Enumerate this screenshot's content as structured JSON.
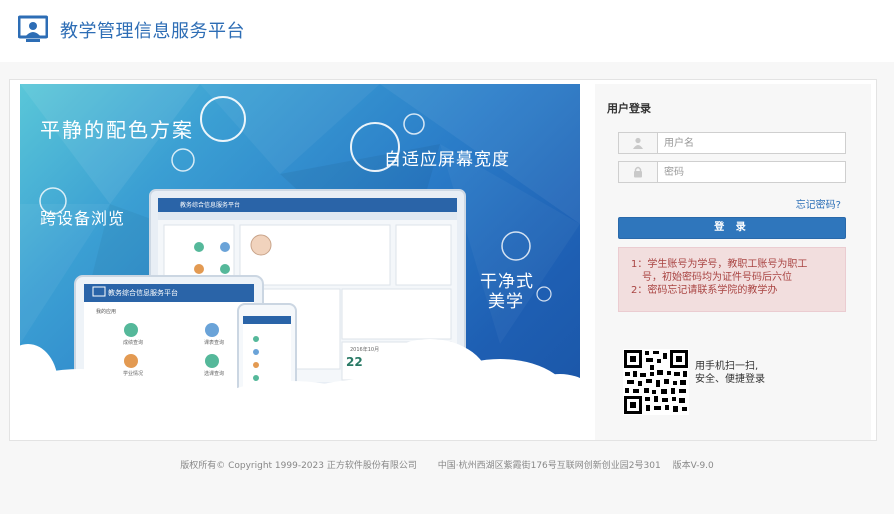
{
  "header": {
    "title": "教学管理信息服务平台",
    "logo_icon": "monitor-user-icon",
    "brand_color": "#2d6db5"
  },
  "banner": {
    "slogan_1": "平静的配色方案",
    "slogan_2": "自适应屏幕宽度",
    "slogan_3": "跨设备浏览",
    "slogan_4a": "干净式",
    "slogan_4b": "美学",
    "monitor_title": "教务综合信息服务平台",
    "tablet_title": "教务综合信息服务平台",
    "tablet_subtitle": "我的应用",
    "tablet_apps": [
      "成绩查询",
      "课表查询",
      "学业情况",
      "选课查询"
    ],
    "calendar_day": "22",
    "calendar_month": "2016年10月"
  },
  "login": {
    "panel_title": "用户登录",
    "username_placeholder": "用户名",
    "password_placeholder": "密码",
    "username_icon": "user-icon",
    "password_icon": "lock-icon",
    "forgot_label": "忘记密码?",
    "login_label": "登 录",
    "notice_line_1": "1：学生账号为学号，教职工账号为职工",
    "notice_line_2": "号，初始密码均为证件号码后六位",
    "notice_line_3": "2：密码忘记请联系学院的教学办",
    "qr_icon": "qr-code-icon",
    "qr_line_1": "用手机扫一扫,",
    "qr_line_2": "安全、便捷登录",
    "accent_color": "#2f76bc"
  },
  "footer": {
    "copyright": "版权所有© Copyright 1999-2023 正方软件股份有限公司",
    "address": "中国·杭州西湖区紫霞街176号互联网创新创业园2号301",
    "version": "版本V-9.0"
  }
}
